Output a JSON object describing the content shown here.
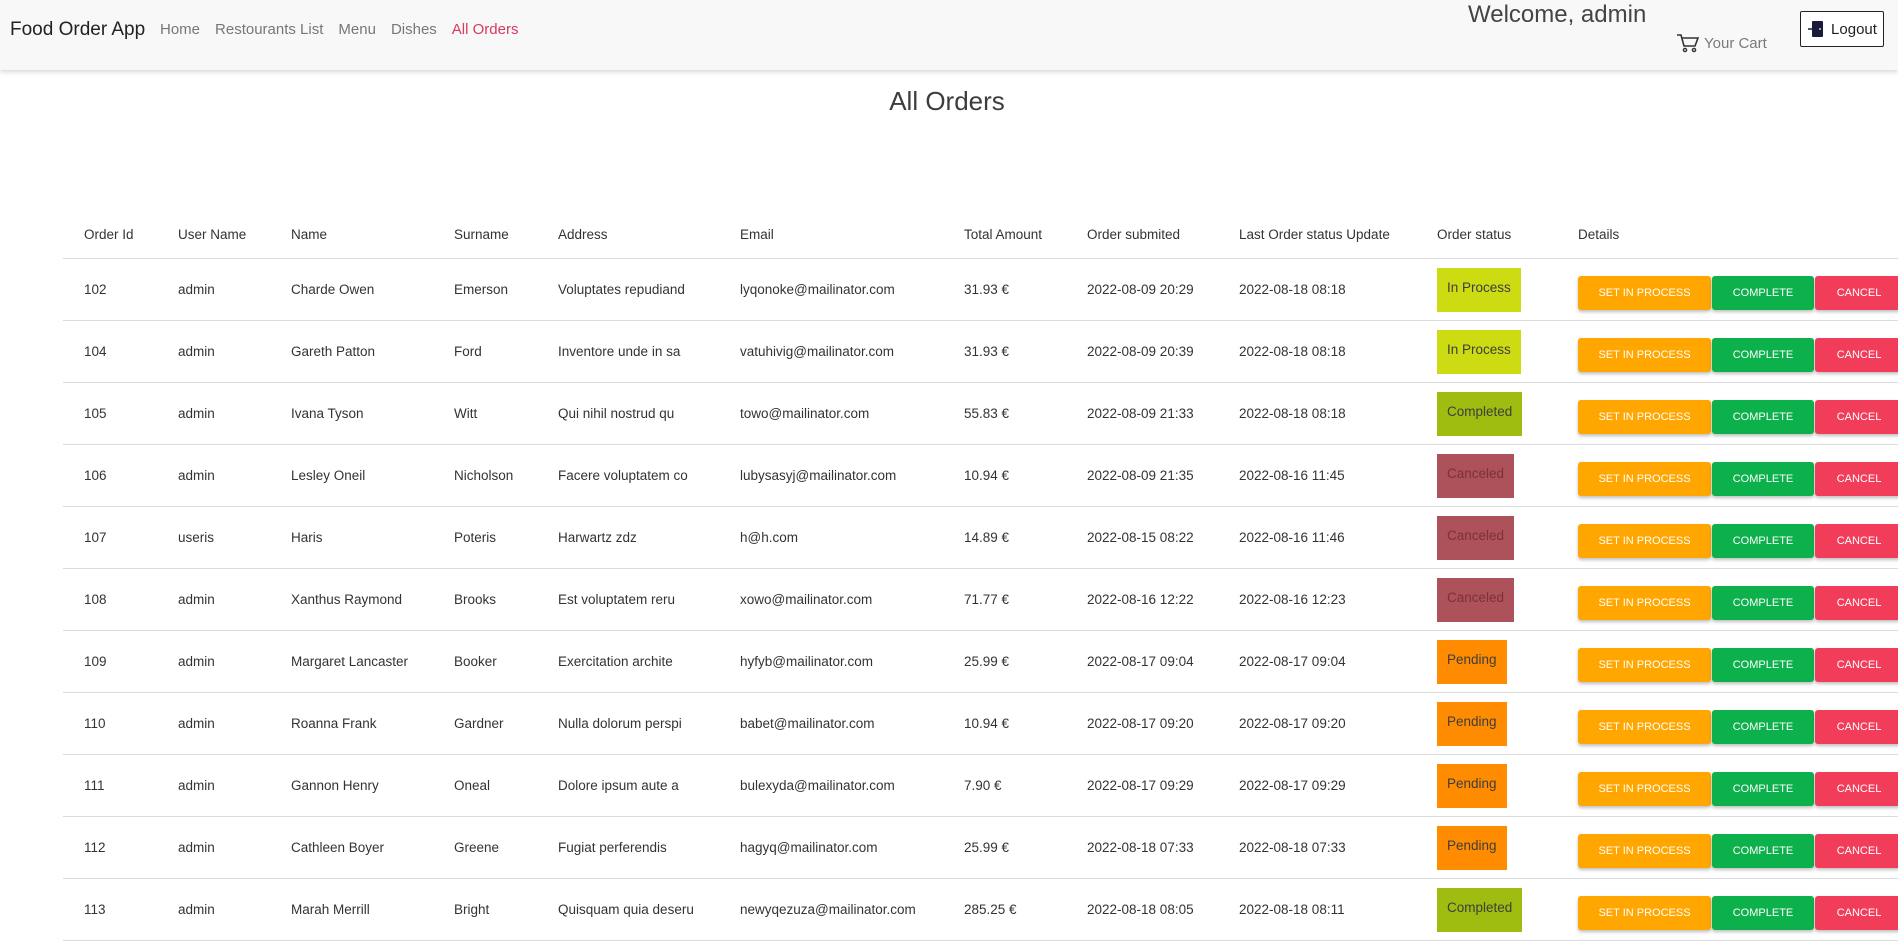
{
  "nav": {
    "brand": "Food Order App",
    "links": [
      "Home",
      "Restourants List",
      "Menu",
      "Dishes",
      "All Orders"
    ],
    "welcome": "Welcome, admin",
    "cart_label": "Your Cart",
    "logout_label": "Logout",
    "active_color": "#d63a5c"
  },
  "page": {
    "title": "All Orders"
  },
  "table": {
    "headers": [
      "Order Id",
      "User Name",
      "Name",
      "Surname",
      "Address",
      "Email",
      "Total Amount",
      "Order submited",
      "Last Order status Update",
      "Order status",
      "Details"
    ],
    "action_labels": {
      "process": "SET IN PROCESS",
      "complete": "COMPLETE",
      "cancel": "CANCEL"
    },
    "status_colors": {
      "In Process": "#cddc12",
      "Completed": "#9ebd10",
      "Canceled": "#ad525a",
      "Pending": "#ff8c00"
    },
    "rows": [
      {
        "id": "102",
        "user": "admin",
        "name": "Charde Owen",
        "surname": "Emerson",
        "address": "Voluptates repudiand",
        "email": "lyqonoke@mailinator.com",
        "total": "31.93 €",
        "submitted": "2022-08-09 20:29",
        "updated": "2022-08-18 08:18",
        "status": "In Process"
      },
      {
        "id": "104",
        "user": "admin",
        "name": "Gareth Patton",
        "surname": "Ford",
        "address": "Inventore unde in sa",
        "email": "vatuhivig@mailinator.com",
        "total": "31.93 €",
        "submitted": "2022-08-09 20:39",
        "updated": "2022-08-18 08:18",
        "status": "In Process"
      },
      {
        "id": "105",
        "user": "admin",
        "name": "Ivana Tyson",
        "surname": "Witt",
        "address": "Qui nihil nostrud qu",
        "email": "towo@mailinator.com",
        "total": "55.83 €",
        "submitted": "2022-08-09 21:33",
        "updated": "2022-08-18 08:18",
        "status": "Completed"
      },
      {
        "id": "106",
        "user": "admin",
        "name": "Lesley Oneil",
        "surname": "Nicholson",
        "address": "Facere voluptatem co",
        "email": "lubysasyj@mailinator.com",
        "total": "10.94 €",
        "submitted": "2022-08-09 21:35",
        "updated": "2022-08-16 11:45",
        "status": "Canceled"
      },
      {
        "id": "107",
        "user": "useris",
        "name": "Haris",
        "surname": "Poteris",
        "address": "Harwartz zdz",
        "email": "h@h.com",
        "total": "14.89 €",
        "submitted": "2022-08-15 08:22",
        "updated": "2022-08-16 11:46",
        "status": "Canceled"
      },
      {
        "id": "108",
        "user": "admin",
        "name": "Xanthus Raymond",
        "surname": "Brooks",
        "address": "Est voluptatem reru",
        "email": "xowo@mailinator.com",
        "total": "71.77 €",
        "submitted": "2022-08-16 12:22",
        "updated": "2022-08-16 12:23",
        "status": "Canceled"
      },
      {
        "id": "109",
        "user": "admin",
        "name": "Margaret Lancaster",
        "surname": "Booker",
        "address": "Exercitation archite",
        "email": "hyfyb@mailinator.com",
        "total": "25.99 €",
        "submitted": "2022-08-17 09:04",
        "updated": "2022-08-17 09:04",
        "status": "Pending"
      },
      {
        "id": "110",
        "user": "admin",
        "name": "Roanna Frank",
        "surname": "Gardner",
        "address": "Nulla dolorum perspi",
        "email": "babet@mailinator.com",
        "total": "10.94 €",
        "submitted": "2022-08-17 09:20",
        "updated": "2022-08-17 09:20",
        "status": "Pending"
      },
      {
        "id": "111",
        "user": "admin",
        "name": "Gannon Henry",
        "surname": "Oneal",
        "address": "Dolore ipsum aute a",
        "email": "bulexyda@mailinator.com",
        "total": "7.90 €",
        "submitted": "2022-08-17 09:29",
        "updated": "2022-08-17 09:29",
        "status": "Pending"
      },
      {
        "id": "112",
        "user": "admin",
        "name": "Cathleen Boyer",
        "surname": "Greene",
        "address": "Fugiat perferendis",
        "email": "hagyq@mailinator.com",
        "total": "25.99 €",
        "submitted": "2022-08-18 07:33",
        "updated": "2022-08-18 07:33",
        "status": "Pending"
      },
      {
        "id": "113",
        "user": "admin",
        "name": "Marah Merrill",
        "surname": "Bright",
        "address": "Quisquam quia deseru",
        "email": "newyqezuza@mailinator.com",
        "total": "285.25 €",
        "submitted": "2022-08-18 08:05",
        "updated": "2022-08-18 08:11",
        "status": "Completed"
      }
    ]
  }
}
